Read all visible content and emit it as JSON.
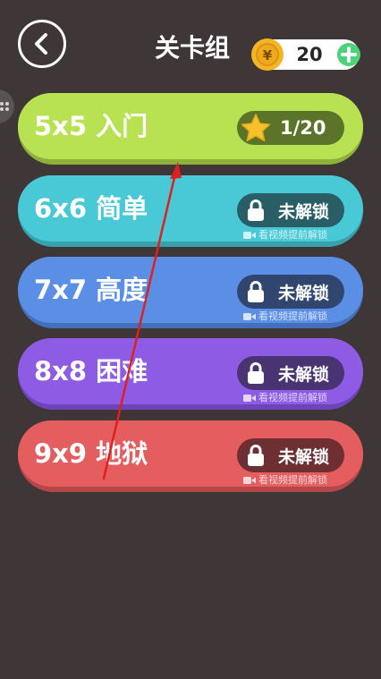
{
  "header": {
    "title": "关卡组",
    "coins": "20"
  },
  "levels": [
    {
      "name": "5x5 入门",
      "status": "1/20",
      "unlocked": true,
      "face": "#b9e253",
      "shadow": "#8fb03b",
      "pill": "#5c7429"
    },
    {
      "name": "6x6 简单",
      "status": "未解锁",
      "hint": "看视频提前解锁",
      "unlocked": false,
      "face": "#49c9d6",
      "shadow": "#37a2ac",
      "pill": "#2a5e66"
    },
    {
      "name": "7x7 高度",
      "status": "未解锁",
      "hint": "看视频提前解锁",
      "unlocked": false,
      "face": "#5b8fe6",
      "shadow": "#4470bb",
      "pill": "#30466f"
    },
    {
      "name": "8x8 困难",
      "status": "未解锁",
      "hint": "看视频提前解锁",
      "unlocked": false,
      "face": "#8e5ce4",
      "shadow": "#6e44b9",
      "pill": "#4a3373"
    },
    {
      "name": "9x9 地狱",
      "status": "未解锁",
      "hint": "看视频提前解锁",
      "unlocked": false,
      "face": "#e45e60",
      "shadow": "#b64749",
      "pill": "#6e2f32"
    }
  ],
  "colors": {
    "background": "#3e3637",
    "coin": "#f4b522",
    "plus": "#4cd37a",
    "arrow": "#e01f1f"
  },
  "icons": {
    "back": "chevron-left-icon",
    "coin": "coin-icon",
    "plus": "plus-icon",
    "star": "star-icon",
    "lock": "lock-icon",
    "video": "video-icon"
  }
}
